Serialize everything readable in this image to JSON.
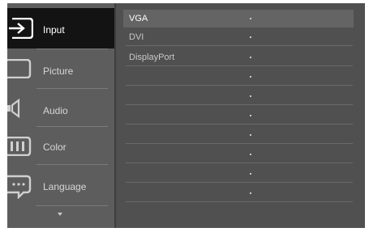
{
  "menu": {
    "items": [
      {
        "label": "Input",
        "icon": "input-icon",
        "selected": true
      },
      {
        "label": "Picture",
        "icon": "picture-icon",
        "selected": false
      },
      {
        "label": "Audio",
        "icon": "audio-icon",
        "selected": false
      },
      {
        "label": "Color",
        "icon": "color-icon",
        "selected": false
      },
      {
        "label": "Language",
        "icon": "language-icon",
        "selected": false
      }
    ],
    "scroll_icon": "chevron-down-icon"
  },
  "submenu": {
    "options": [
      {
        "label": "VGA",
        "selected": true
      },
      {
        "label": "DVI",
        "selected": false
      },
      {
        "label": "DisplayPort",
        "selected": false
      },
      {
        "label": "",
        "selected": false
      },
      {
        "label": "",
        "selected": false
      },
      {
        "label": "",
        "selected": false
      },
      {
        "label": "",
        "selected": false
      },
      {
        "label": "",
        "selected": false
      },
      {
        "label": "",
        "selected": false
      },
      {
        "label": "",
        "selected": false
      }
    ]
  },
  "colors": {
    "selected_menu_bg": "#131313",
    "selected_option_bg": "#646464",
    "panel_bg": "#505050"
  }
}
